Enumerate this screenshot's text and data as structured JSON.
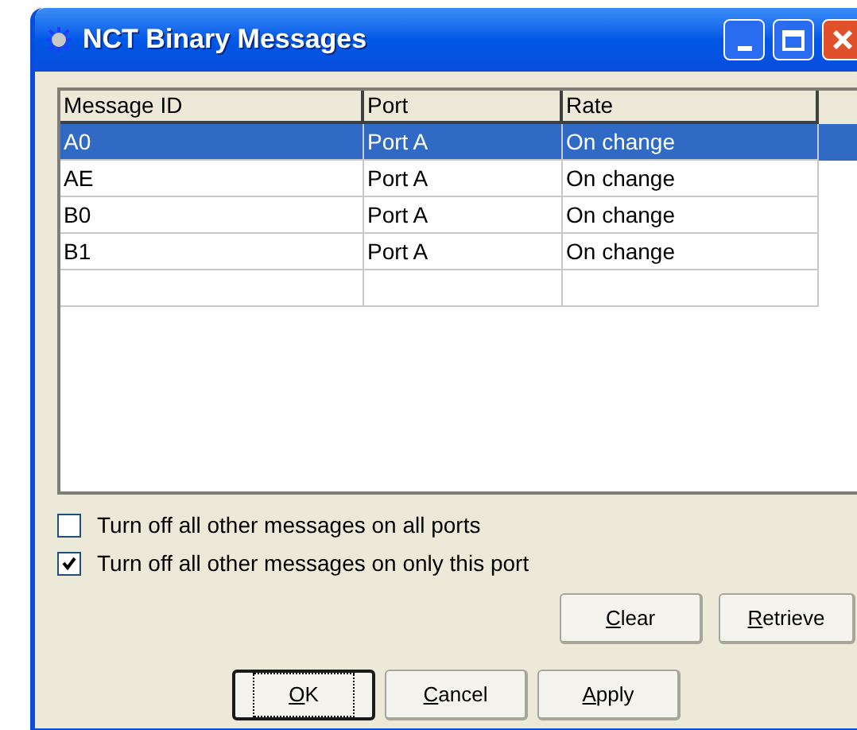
{
  "window": {
    "title": "NCT Binary Messages"
  },
  "table": {
    "columns": [
      "Message ID",
      "Port",
      "Rate"
    ],
    "rows": [
      {
        "cells": [
          "A0",
          "Port A",
          "On change"
        ],
        "selected": true
      },
      {
        "cells": [
          "AE",
          "Port A",
          "On change"
        ],
        "selected": false
      },
      {
        "cells": [
          "B0",
          "Port A",
          "On change"
        ],
        "selected": false
      },
      {
        "cells": [
          "B1",
          "Port A",
          "On change"
        ],
        "selected": false
      }
    ]
  },
  "options": [
    {
      "label": "Turn off all other messages on all ports",
      "checked": false
    },
    {
      "label": "Turn off all other messages on only this port",
      "checked": true
    }
  ],
  "side_buttons": [
    {
      "key": "C",
      "rest": "lear"
    },
    {
      "key": "R",
      "rest": "etrieve"
    }
  ],
  "buttons": [
    {
      "key": "O",
      "rest": "K",
      "default": true
    },
    {
      "key": "C",
      "rest": "ancel",
      "default": false
    },
    {
      "key": "A",
      "rest": "pply",
      "default": false
    }
  ]
}
